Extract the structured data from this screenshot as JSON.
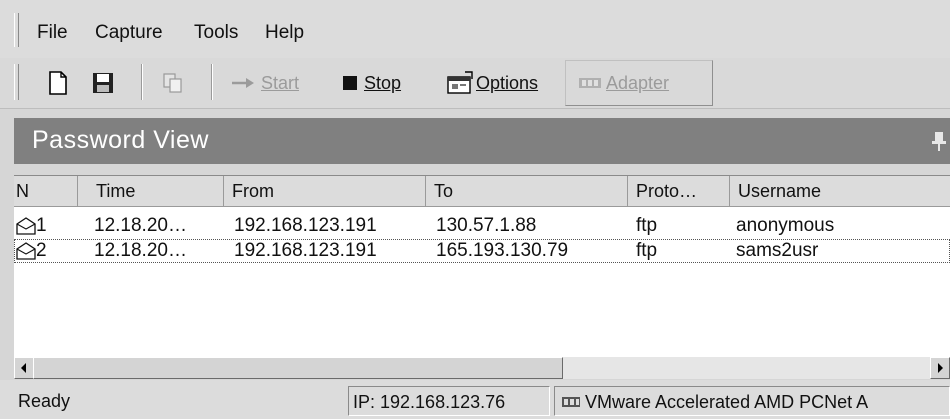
{
  "menu": [
    "File",
    "Capture",
    "Tools",
    "Help"
  ],
  "toolbar": {
    "start_label": "Start",
    "stop_label": "Stop",
    "options_label": "Options",
    "adapter_label": "Adapter",
    "icons": [
      "new-file-icon",
      "save-icon",
      "copy-icon",
      "start-arrow-icon",
      "stop-square-icon",
      "options-icon",
      "adapter-icon"
    ]
  },
  "banner": {
    "title": "Password View"
  },
  "list": {
    "columns": [
      "N",
      "Time",
      "From",
      "To",
      "Proto…",
      "Username"
    ],
    "rows": [
      {
        "n": "1",
        "time": "12.18.20…",
        "from": "192.168.123.191",
        "to": "130.57.1.88",
        "proto": "ftp",
        "username": "anonymous"
      },
      {
        "n": "2",
        "time": "12.18.20…",
        "from": "192.168.123.191",
        "to": "165.193.130.79",
        "proto": "ftp",
        "username": "sams2usr"
      }
    ]
  },
  "status": {
    "state": "Ready",
    "ip": "IP: 192.168.123.76",
    "adapter": "VMware Accelerated AMD PCNet A"
  },
  "colors": {
    "banner": "#808080",
    "menubar": "#dcdcdc",
    "list_bg": "#ffffff"
  }
}
